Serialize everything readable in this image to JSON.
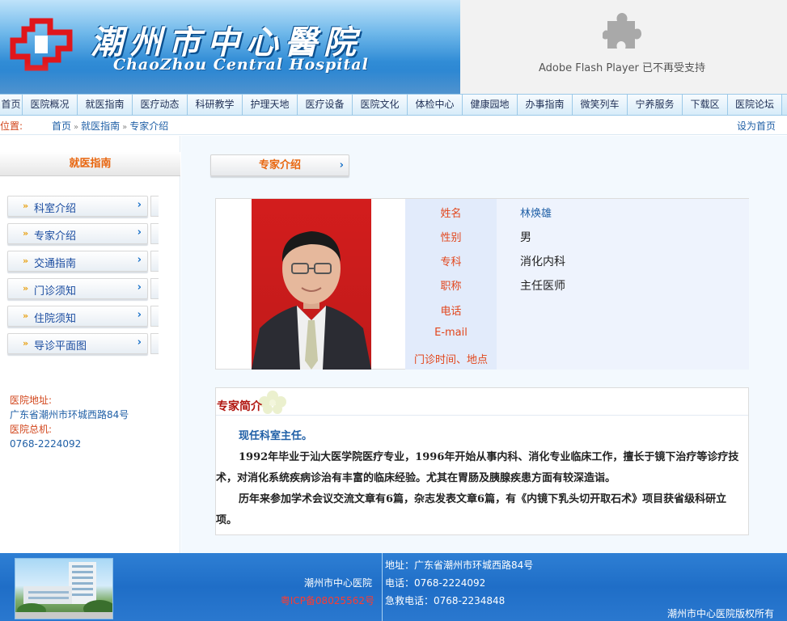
{
  "header": {
    "title": "潮州市中心醫院",
    "subtitle": "ChaoZhou Central Hospital",
    "flash_notice": "Adobe Flash Player 已不再受支持"
  },
  "nav": {
    "items": [
      {
        "label": "首页",
        "w": 28
      },
      {
        "label": "医院概况",
        "w": 68
      },
      {
        "label": "就医指南",
        "w": 68
      },
      {
        "label": "医疗动态",
        "w": 68
      },
      {
        "label": "科研教学",
        "w": 68
      },
      {
        "label": "护理天地",
        "w": 68
      },
      {
        "label": "医疗设备",
        "w": 68
      },
      {
        "label": "医院文化",
        "w": 68
      },
      {
        "label": "体检中心",
        "w": 68
      },
      {
        "label": "健康园地",
        "w": 68
      },
      {
        "label": "办事指南",
        "w": 68
      },
      {
        "label": "微笑列车",
        "w": 68
      },
      {
        "label": "宁养服务",
        "w": 68
      },
      {
        "label": "下载区",
        "w": 56
      },
      {
        "label": "医院论坛",
        "w": 67
      }
    ]
  },
  "breadcrumb": {
    "label": "位置:",
    "path": [
      "首页",
      "就医指南",
      "专家介绍"
    ],
    "set_home": "设为首页"
  },
  "sidebar": {
    "heading": "就医指南",
    "items": [
      "科室介绍",
      "专家介绍",
      "交通指南",
      "门诊须知",
      "住院须知",
      "导诊平面图"
    ],
    "address_label": "医院地址:",
    "address_value": "广东省潮州市环城西路84号",
    "phone_label": "医院总机:",
    "phone_value": "0768-2224092"
  },
  "main": {
    "tab_title": "专家介绍",
    "profile": {
      "labels": [
        "姓名",
        "性别",
        "专科",
        "职称",
        "电话",
        "E-mail",
        "门诊时间、地点"
      ],
      "name": "林焕雄",
      "gender": "男",
      "specialty": "消化内科",
      "title": "主任医师"
    },
    "intro": {
      "heading": "专家简介",
      "role": "现任科室主任。",
      "paragraphs": [
        "1992年毕业于汕大医学院医疗专业，1996年开始从事内科、消化专业临床工作，擅长于镜下治疗等诊疗技术，对消化系统疾病诊治有丰富的临床经验。尤其在胃肠及胰腺疾患方面有较深造诣。",
        "历年来参加学术会议交流文章有6篇，杂志发表文章6篇，有《内镜下乳头切开取石术》项目获省级科研立项。"
      ]
    }
  },
  "footer": {
    "hospital_name": "潮州市中心医院",
    "icp": "粤ICP备08025562号",
    "address": "地址：广东省潮州市环城西路84号",
    "phone": "电话：0768-2224092",
    "emergency": "急救电话：0768-2234848",
    "copyright": "潮州市中心医院版权所有"
  },
  "colors": {
    "accent_orange": "#e8660f",
    "link_blue": "#1f5fa6",
    "label_red": "#e2461c",
    "footer_blue": "#1f6ec7"
  }
}
